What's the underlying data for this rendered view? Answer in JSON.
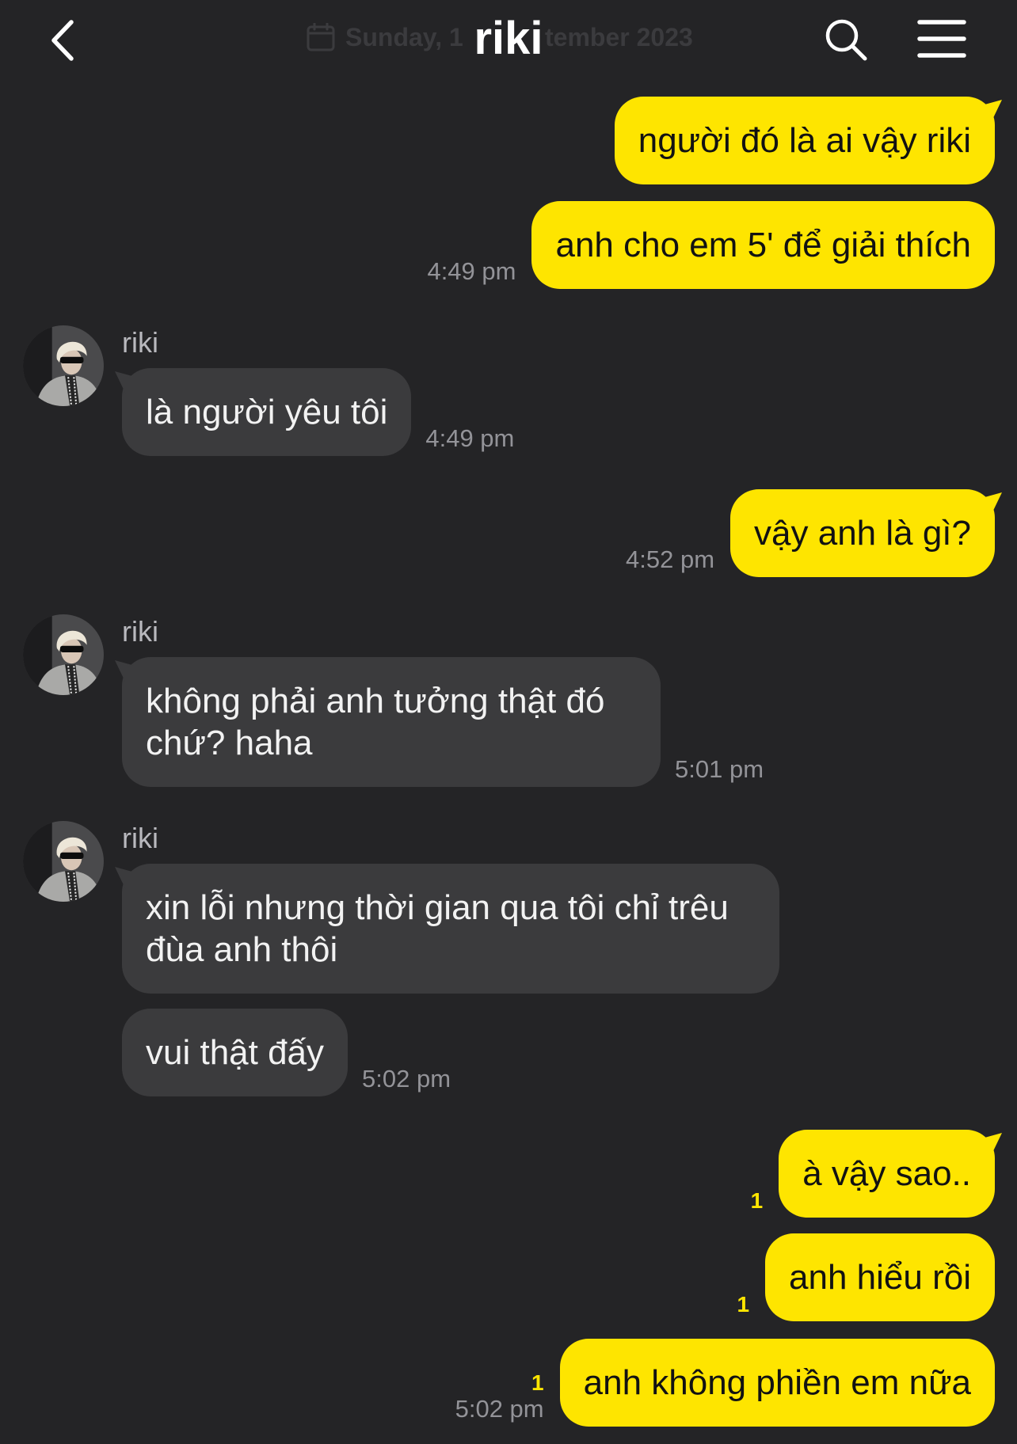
{
  "header": {
    "title": "riki",
    "date_fragments": [
      "Sunday, 1",
      "tember 2023"
    ],
    "icons": {
      "back": "chevron-left-icon",
      "calendar": "calendar-icon",
      "search": "search-icon",
      "menu": "menu-icon"
    }
  },
  "colors": {
    "background": "#242426",
    "sent_bubble": "#fee500",
    "received_bubble": "#3b3b3d",
    "unread_count": "#fee500",
    "timestamp": "#939398"
  },
  "messages": [
    {
      "text": "người đó là ai vậy riki"
    },
    {
      "text": "anh cho em 5' để giải thích",
      "time": "4:49 pm"
    },
    {
      "sender": "riki",
      "text": "là người yêu tôi",
      "time": "4:49 pm"
    },
    {
      "text": "vậy anh là gì?",
      "time": "4:52 pm"
    },
    {
      "sender": "riki",
      "text": "không phải anh tưởng thật đó chứ? haha",
      "time": "5:01 pm"
    },
    {
      "sender": "riki",
      "text": "xin lỗi nhưng thời gian qua tôi chỉ trêu đùa anh thôi"
    },
    {
      "text": "vui thật đấy",
      "time": "5:02 pm"
    },
    {
      "text": "à vậy sao..",
      "unread": 1
    },
    {
      "text": "anh hiểu rồi",
      "unread": 1
    },
    {
      "text": "anh không phiền em nữa",
      "unread": 1,
      "time": "5:02 pm"
    }
  ]
}
